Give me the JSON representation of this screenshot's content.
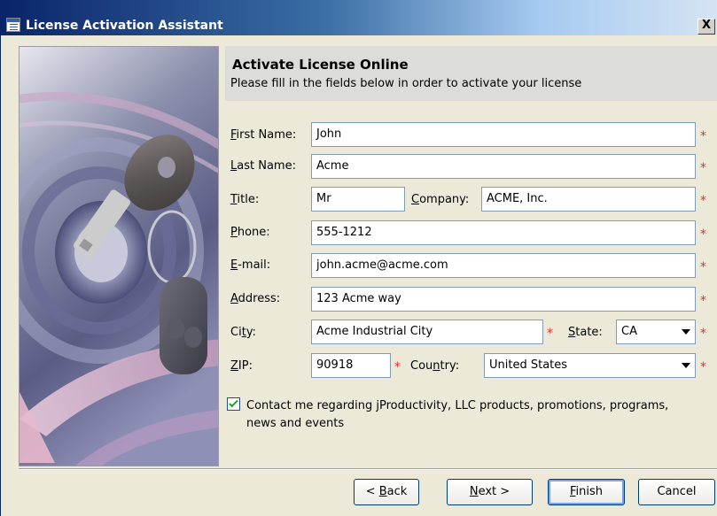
{
  "window": {
    "title": "License Activation Assistant",
    "close_label": "X"
  },
  "header": {
    "title": "Activate License Online",
    "subtitle": "Please fill in the fields below in order to activate your license"
  },
  "form": {
    "first_name": {
      "label": "First Name:",
      "mnemonic": "F",
      "value": "John"
    },
    "last_name": {
      "label": "Last Name:",
      "mnemonic": "L",
      "value": "Acme"
    },
    "title": {
      "label": "Title:",
      "mnemonic": "T",
      "value": "Mr"
    },
    "company": {
      "label": "Company:",
      "mnemonic": "C",
      "value": "ACME, Inc."
    },
    "phone": {
      "label": "Phone:",
      "mnemonic": "P",
      "value": "555-1212"
    },
    "email": {
      "label": "E-mail:",
      "mnemonic": "E",
      "value": "john.acme@acme.com"
    },
    "address": {
      "label": "Address:",
      "mnemonic": "A",
      "value": "123 Acme way"
    },
    "city": {
      "label": "City:",
      "mnemonic": "t",
      "value": "Acme Industrial City"
    },
    "state": {
      "label": "State:",
      "mnemonic": "S",
      "value": "CA"
    },
    "zip": {
      "label": "ZIP:",
      "mnemonic": "Z",
      "value": "90918"
    },
    "country": {
      "label": "Country:",
      "mnemonic": "n",
      "value": "United States"
    },
    "required_mark": "*",
    "contact": {
      "checked": true,
      "text": "Contact me regarding jProductivity, LLC products, promotions, programs, news and events"
    }
  },
  "buttons": {
    "back": "< Back",
    "next": "Next >",
    "finish": "Finish",
    "cancel": "Cancel"
  },
  "colors": {
    "required": "#e03030",
    "title_bar": "#0a246a",
    "field_border": "#7f9db9"
  }
}
